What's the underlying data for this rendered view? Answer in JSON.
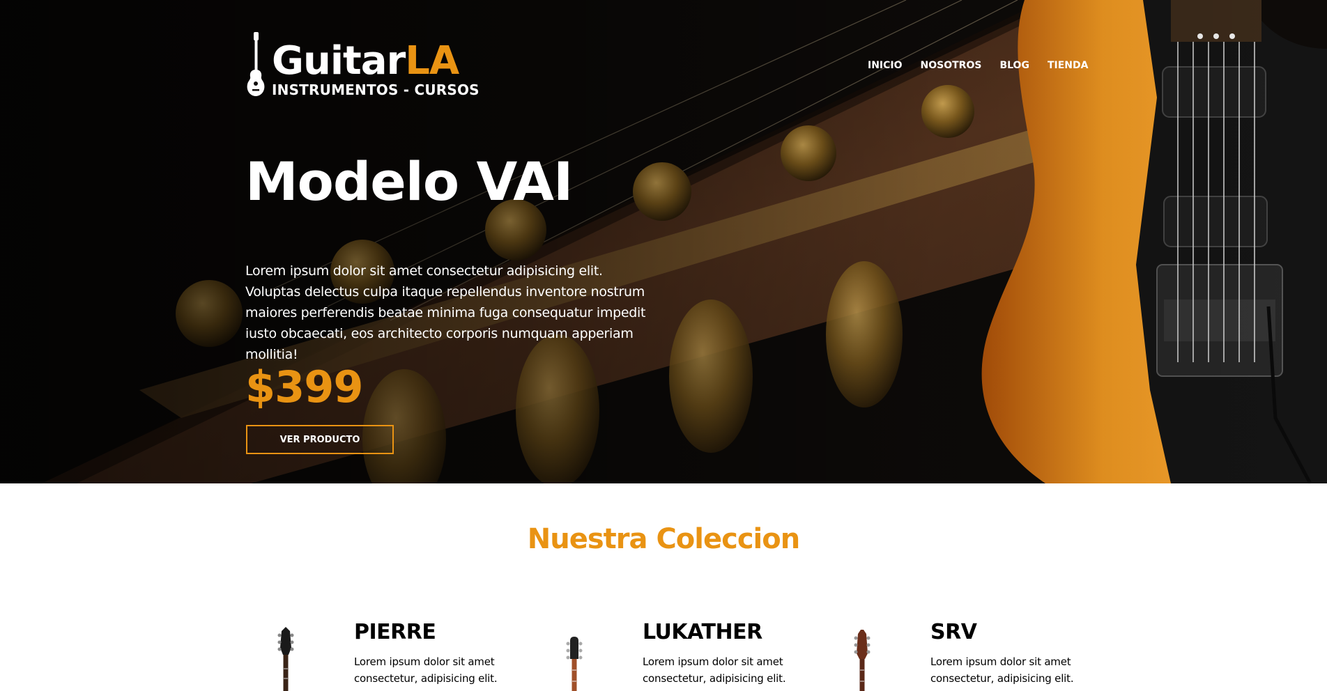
{
  "brand": {
    "name_part1": "Guitar",
    "name_part2": "LA",
    "tagline": "INSTRUMENTOS - CURSOS",
    "icon": "guitar-icon"
  },
  "nav": {
    "items": [
      {
        "label": "INICIO"
      },
      {
        "label": "NOSOTROS"
      },
      {
        "label": "BLOG"
      },
      {
        "label": "TIENDA"
      }
    ]
  },
  "hero": {
    "title": "Modelo VAI",
    "description": "Lorem ipsum dolor sit amet consectetur adipisicing elit. Voluptas delectus culpa itaque repellendus inventore nostrum maiores perferendis beatae minima fuga consequatur impedit iusto obcaecati, eos architecto corporis numquam apperiam mollitia!",
    "price": "$399",
    "button_label": "VER PRODUCTO"
  },
  "collection": {
    "title": "Nuestra Coleccion",
    "products": [
      {
        "name": "PIERRE",
        "description": "Lorem ipsum dolor sit amet consectetur, adipisicing elit."
      },
      {
        "name": "LUKATHER",
        "description": "Lorem ipsum dolor sit amet consectetur, adipisicing elit."
      },
      {
        "name": "SRV",
        "description": "Lorem ipsum dolor sit amet consectetur, adipisicing elit."
      }
    ]
  },
  "colors": {
    "accent": "#e99313",
    "hero_background": "#0e0b09",
    "text_light": "#ffffff",
    "text_dark": "#000000"
  }
}
